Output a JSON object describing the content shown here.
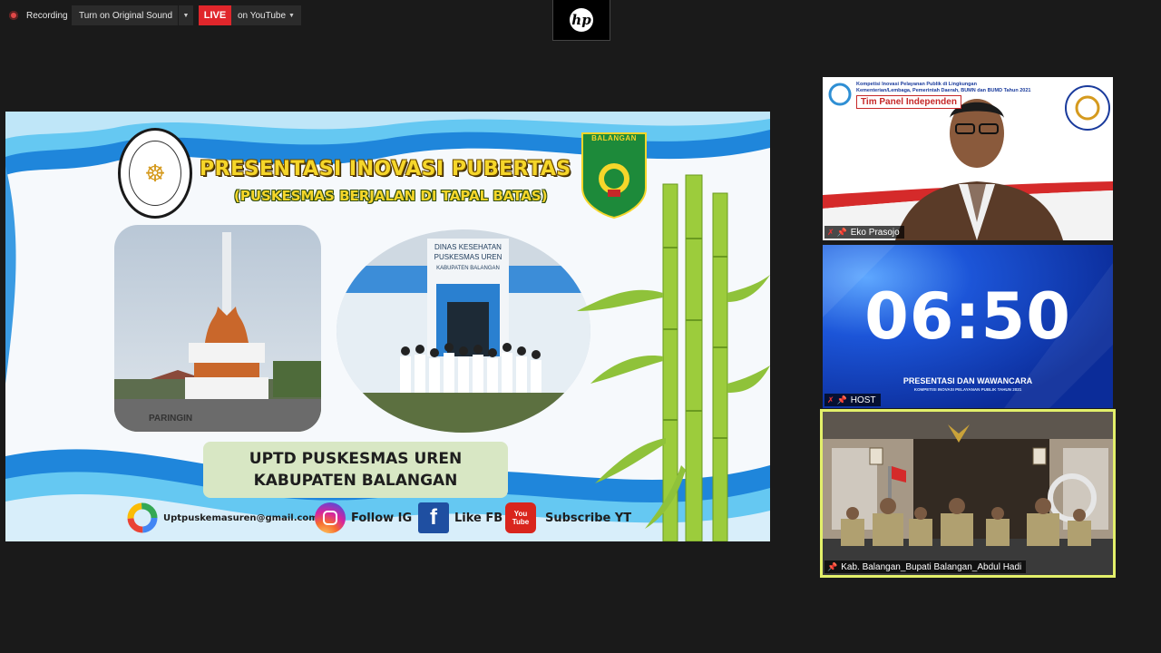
{
  "top_bar": {
    "recording_label": "Recording",
    "sound_button_label": "Turn on Original Sound",
    "live_badge": "LIVE",
    "stream_destination": "on YouTube",
    "brand_logo_text": "hp"
  },
  "slide": {
    "title": "PRESENTASI INOVASI PUBERTAS",
    "subtitle": "(PUSKESMAS BERJALAN DI TAPAL BATAS)",
    "right_logo_label": "BALANGAN",
    "monument_caption": "PARINGIN",
    "building_sign": [
      "DINAS KESEHATAN",
      "PUSKESMAS UREN",
      "KABUPATEN BALANGAN"
    ],
    "unit_name_line1": "UPTD PUSKESMAS UREN",
    "unit_name_line2": "KABUPATEN BALANGAN",
    "social": {
      "email": "Uptpuskemasuren@gmail.com",
      "instagram": "Follow IG",
      "facebook": "Like FB",
      "youtube": "Subscribe YT",
      "youtube_icon_text": "You Tube"
    }
  },
  "participants": [
    {
      "name": "Eko Prasojo",
      "header_line1": "Kompetisi Inovasi Pelayanan Publik di Lingkungan",
      "header_line2": "Kementerian/Lembaga, Pemerintah Daerah, BUMN dan BUMD Tahun 2021",
      "panel_label": "Tim Panel Independen"
    },
    {
      "name": "HOST",
      "timer": "06:50",
      "subtitle": "PRESENTASI DAN WAWANCARA",
      "subtitle2": "KOMPETISI INOVASI PELAYANAN PUBLIK TAHUN 2021"
    },
    {
      "name": "Kab. Balangan_Bupati Balangan_Abdul Hadi"
    }
  ],
  "colors": {
    "live": "#e0262b",
    "active_speaker_border": "#e3f06a",
    "timer_bg": "#1442c9",
    "title_yellow": "#f5d62a"
  }
}
